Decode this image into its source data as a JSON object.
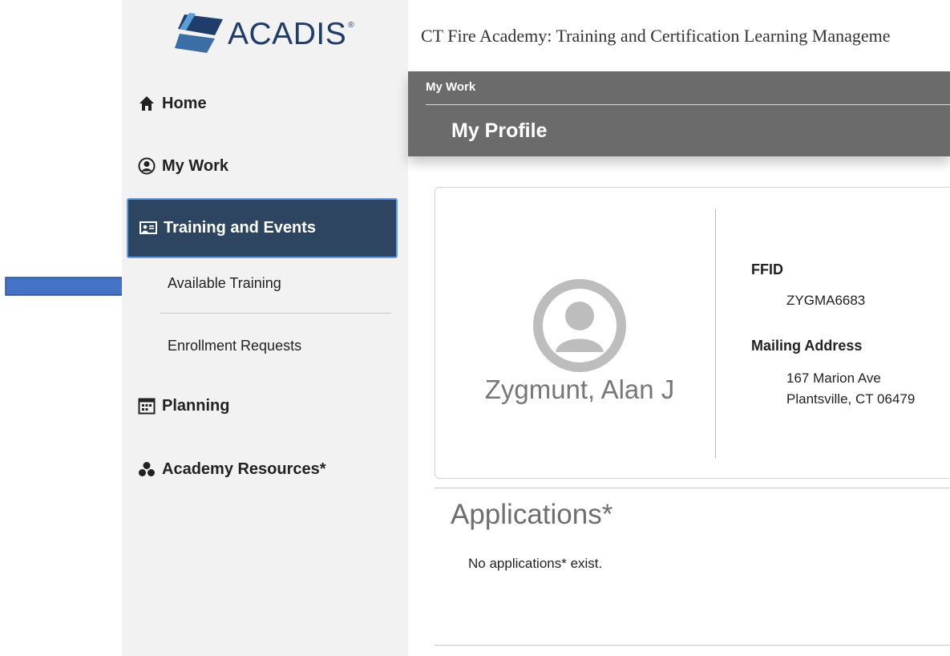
{
  "sidebar": {
    "logo_text": "ACADIS",
    "logo_registered": "®",
    "nav": {
      "home": "Home",
      "my_work": "My Work",
      "training_events": "Training and Events",
      "planning": "Planning",
      "academy_resources": "Academy Resources*"
    },
    "training_sub": {
      "available_training": "Available Training",
      "enrollment_requests": "Enrollment Requests"
    }
  },
  "header": {
    "app_title": "CT Fire Academy: Training and Certification Learning Manageme",
    "breadcrumb": "My Work",
    "page_title": "My Profile"
  },
  "profile": {
    "name": "Zygmunt, Alan J",
    "ffid_label": "FFID",
    "ffid_value": "ZYGMA6683",
    "mailing_label": "Mailing Address",
    "address_line1": "167 Marion Ave",
    "address_line2": "Plantsville, CT  06479"
  },
  "applications": {
    "title": "Applications*",
    "empty_message": "No applications* exist."
  },
  "colors": {
    "sidebar_bg": "#f2f2f2",
    "active_nav_bg": "#2e4561",
    "active_nav_border": "#5aa0ea",
    "header_bar_bg": "#6b6b6b",
    "annotation_arrow": "#4472c4",
    "logo_blue": "#1f3c6b"
  },
  "icons": {
    "home": "home-icon",
    "my_work": "user-circle-icon",
    "training_events": "presentation-icon",
    "planning": "calendar-icon",
    "academy_resources": "cluster-icon",
    "avatar": "default-avatar-icon",
    "annotation": "right-arrow-icon"
  }
}
